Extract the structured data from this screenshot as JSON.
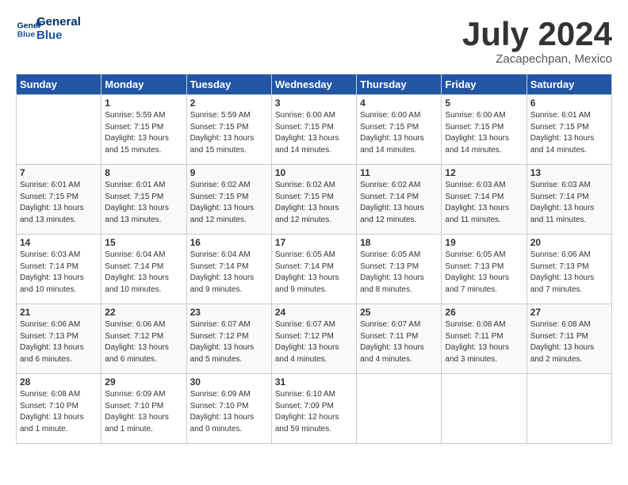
{
  "logo": {
    "line1": "General",
    "line2": "Blue"
  },
  "title": "July 2024",
  "location": "Zacapechpan, Mexico",
  "header": {
    "days": [
      "Sunday",
      "Monday",
      "Tuesday",
      "Wednesday",
      "Thursday",
      "Friday",
      "Saturday"
    ]
  },
  "weeks": [
    [
      {
        "day": "",
        "sunrise": "",
        "sunset": "",
        "daylight": ""
      },
      {
        "day": "1",
        "sunrise": "Sunrise: 5:59 AM",
        "sunset": "Sunset: 7:15 PM",
        "daylight": "Daylight: 13 hours and 15 minutes."
      },
      {
        "day": "2",
        "sunrise": "Sunrise: 5:59 AM",
        "sunset": "Sunset: 7:15 PM",
        "daylight": "Daylight: 13 hours and 15 minutes."
      },
      {
        "day": "3",
        "sunrise": "Sunrise: 6:00 AM",
        "sunset": "Sunset: 7:15 PM",
        "daylight": "Daylight: 13 hours and 14 minutes."
      },
      {
        "day": "4",
        "sunrise": "Sunrise: 6:00 AM",
        "sunset": "Sunset: 7:15 PM",
        "daylight": "Daylight: 13 hours and 14 minutes."
      },
      {
        "day": "5",
        "sunrise": "Sunrise: 6:00 AM",
        "sunset": "Sunset: 7:15 PM",
        "daylight": "Daylight: 13 hours and 14 minutes."
      },
      {
        "day": "6",
        "sunrise": "Sunrise: 6:01 AM",
        "sunset": "Sunset: 7:15 PM",
        "daylight": "Daylight: 13 hours and 14 minutes."
      }
    ],
    [
      {
        "day": "7",
        "sunrise": "Sunrise: 6:01 AM",
        "sunset": "Sunset: 7:15 PM",
        "daylight": "Daylight: 13 hours and 13 minutes."
      },
      {
        "day": "8",
        "sunrise": "Sunrise: 6:01 AM",
        "sunset": "Sunset: 7:15 PM",
        "daylight": "Daylight: 13 hours and 13 minutes."
      },
      {
        "day": "9",
        "sunrise": "Sunrise: 6:02 AM",
        "sunset": "Sunset: 7:15 PM",
        "daylight": "Daylight: 13 hours and 12 minutes."
      },
      {
        "day": "10",
        "sunrise": "Sunrise: 6:02 AM",
        "sunset": "Sunset: 7:15 PM",
        "daylight": "Daylight: 13 hours and 12 minutes."
      },
      {
        "day": "11",
        "sunrise": "Sunrise: 6:02 AM",
        "sunset": "Sunset: 7:14 PM",
        "daylight": "Daylight: 13 hours and 12 minutes."
      },
      {
        "day": "12",
        "sunrise": "Sunrise: 6:03 AM",
        "sunset": "Sunset: 7:14 PM",
        "daylight": "Daylight: 13 hours and 11 minutes."
      },
      {
        "day": "13",
        "sunrise": "Sunrise: 6:03 AM",
        "sunset": "Sunset: 7:14 PM",
        "daylight": "Daylight: 13 hours and 11 minutes."
      }
    ],
    [
      {
        "day": "14",
        "sunrise": "Sunrise: 6:03 AM",
        "sunset": "Sunset: 7:14 PM",
        "daylight": "Daylight: 13 hours and 10 minutes."
      },
      {
        "day": "15",
        "sunrise": "Sunrise: 6:04 AM",
        "sunset": "Sunset: 7:14 PM",
        "daylight": "Daylight: 13 hours and 10 minutes."
      },
      {
        "day": "16",
        "sunrise": "Sunrise: 6:04 AM",
        "sunset": "Sunset: 7:14 PM",
        "daylight": "Daylight: 13 hours and 9 minutes."
      },
      {
        "day": "17",
        "sunrise": "Sunrise: 6:05 AM",
        "sunset": "Sunset: 7:14 PM",
        "daylight": "Daylight: 13 hours and 9 minutes."
      },
      {
        "day": "18",
        "sunrise": "Sunrise: 6:05 AM",
        "sunset": "Sunset: 7:13 PM",
        "daylight": "Daylight: 13 hours and 8 minutes."
      },
      {
        "day": "19",
        "sunrise": "Sunrise: 6:05 AM",
        "sunset": "Sunset: 7:13 PM",
        "daylight": "Daylight: 13 hours and 7 minutes."
      },
      {
        "day": "20",
        "sunrise": "Sunrise: 6:06 AM",
        "sunset": "Sunset: 7:13 PM",
        "daylight": "Daylight: 13 hours and 7 minutes."
      }
    ],
    [
      {
        "day": "21",
        "sunrise": "Sunrise: 6:06 AM",
        "sunset": "Sunset: 7:13 PM",
        "daylight": "Daylight: 13 hours and 6 minutes."
      },
      {
        "day": "22",
        "sunrise": "Sunrise: 6:06 AM",
        "sunset": "Sunset: 7:12 PM",
        "daylight": "Daylight: 13 hours and 6 minutes."
      },
      {
        "day": "23",
        "sunrise": "Sunrise: 6:07 AM",
        "sunset": "Sunset: 7:12 PM",
        "daylight": "Daylight: 13 hours and 5 minutes."
      },
      {
        "day": "24",
        "sunrise": "Sunrise: 6:07 AM",
        "sunset": "Sunset: 7:12 PM",
        "daylight": "Daylight: 13 hours and 4 minutes."
      },
      {
        "day": "25",
        "sunrise": "Sunrise: 6:07 AM",
        "sunset": "Sunset: 7:11 PM",
        "daylight": "Daylight: 13 hours and 4 minutes."
      },
      {
        "day": "26",
        "sunrise": "Sunrise: 6:08 AM",
        "sunset": "Sunset: 7:11 PM",
        "daylight": "Daylight: 13 hours and 3 minutes."
      },
      {
        "day": "27",
        "sunrise": "Sunrise: 6:08 AM",
        "sunset": "Sunset: 7:11 PM",
        "daylight": "Daylight: 13 hours and 2 minutes."
      }
    ],
    [
      {
        "day": "28",
        "sunrise": "Sunrise: 6:08 AM",
        "sunset": "Sunset: 7:10 PM",
        "daylight": "Daylight: 13 hours and 1 minute."
      },
      {
        "day": "29",
        "sunrise": "Sunrise: 6:09 AM",
        "sunset": "Sunset: 7:10 PM",
        "daylight": "Daylight: 13 hours and 1 minute."
      },
      {
        "day": "30",
        "sunrise": "Sunrise: 6:09 AM",
        "sunset": "Sunset: 7:10 PM",
        "daylight": "Daylight: 13 hours and 0 minutes."
      },
      {
        "day": "31",
        "sunrise": "Sunrise: 6:10 AM",
        "sunset": "Sunset: 7:09 PM",
        "daylight": "Daylight: 12 hours and 59 minutes."
      },
      {
        "day": "",
        "sunrise": "",
        "sunset": "",
        "daylight": ""
      },
      {
        "day": "",
        "sunrise": "",
        "sunset": "",
        "daylight": ""
      },
      {
        "day": "",
        "sunrise": "",
        "sunset": "",
        "daylight": ""
      }
    ]
  ]
}
